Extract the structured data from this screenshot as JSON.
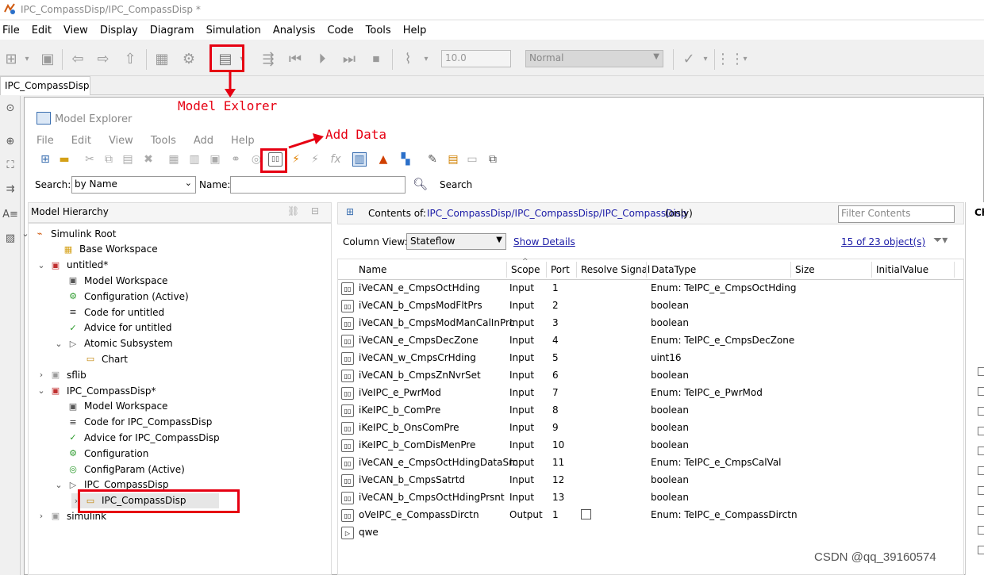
{
  "window": {
    "title": "IPC_CompassDisp/IPC_CompassDisp *"
  },
  "menu": [
    "File",
    "Edit",
    "View",
    "Display",
    "Diagram",
    "Simulation",
    "Analysis",
    "Code",
    "Tools",
    "Help"
  ],
  "toolbar": {
    "stop_time": "10.0",
    "sim_mode": "Normal"
  },
  "tab": {
    "label": "IPC_CompassDisp"
  },
  "model_explorer": {
    "title": "Model Explorer",
    "menu": [
      "File",
      "Edit",
      "View",
      "Tools",
      "Add",
      "Help"
    ],
    "search": {
      "search_label": "Search:",
      "by_value": "by Name",
      "name_label": "Name:",
      "name_value": "",
      "search_button": "Search"
    },
    "hierarchy": {
      "header": "Model Hierarchy",
      "nodes": [
        {
          "label": "Simulink Root",
          "arrow": "v",
          "icon": "simulink-root-icon"
        },
        {
          "label": "Base Workspace",
          "arrow": "",
          "icon": "workspace-icon"
        },
        {
          "label": "untitled*",
          "arrow": "v",
          "icon": "model-icon"
        },
        {
          "label": "Model Workspace",
          "arrow": "",
          "icon": "model-workspace-icon"
        },
        {
          "label": "Configuration (Active)",
          "arrow": "",
          "icon": "configuration-icon"
        },
        {
          "label": "Code for untitled",
          "arrow": "",
          "icon": "code-icon"
        },
        {
          "label": "Advice for untitled",
          "arrow": "",
          "icon": "advice-icon"
        },
        {
          "label": "Atomic Subsystem",
          "arrow": "v",
          "icon": "subsystem-icon"
        },
        {
          "label": "Chart",
          "arrow": "",
          "icon": "chart-icon"
        },
        {
          "label": "sflib",
          "arrow": ">",
          "icon": "library-icon"
        },
        {
          "label": "IPC_CompassDisp*",
          "arrow": "v",
          "icon": "model-icon"
        },
        {
          "label": "Model Workspace",
          "arrow": "",
          "icon": "model-workspace-icon"
        },
        {
          "label": "Code for IPC_CompassDisp",
          "arrow": "",
          "icon": "code-icon"
        },
        {
          "label": "Advice for IPC_CompassDisp",
          "arrow": "",
          "icon": "advice-icon"
        },
        {
          "label": "Configuration",
          "arrow": "",
          "icon": "configuration-icon"
        },
        {
          "label": "ConfigParam (Active)",
          "arrow": "",
          "icon": "configparam-icon"
        },
        {
          "label": "IPC_CompassDisp",
          "arrow": "v",
          "icon": "subsystem-icon"
        },
        {
          "label": "IPC_CompassDisp",
          "arrow": ">",
          "icon": "chart-icon"
        },
        {
          "label": "simulink",
          "arrow": ">",
          "icon": "library-icon"
        }
      ]
    },
    "contents": {
      "label": "Contents of:",
      "path": "IPC_CompassDisp/IPC_CompassDisp/IPC_CompassDisp",
      "scope_note": "(only)",
      "filter_placeholder": "Filter Contents",
      "column_view_label": "Column View:",
      "column_view_value": "Stateflow",
      "show_details": "Show Details",
      "count": "15 of 23 object(s)",
      "columns": [
        "Name",
        "Scope",
        "Port",
        "Resolve Signal",
        "DataType",
        "Size",
        "InitialValue"
      ],
      "rows": [
        {
          "name": "iVeCAN_e_CmpsOctHding",
          "scope": "Input",
          "port": "1",
          "datatype": "Enum: TeIPC_e_CmpsOctHding"
        },
        {
          "name": "iVeCAN_b_CmpsModFltPrs",
          "scope": "Input",
          "port": "2",
          "datatype": "boolean"
        },
        {
          "name": "iVeCAN_b_CmpsModManCalInPrc",
          "scope": "Input",
          "port": "3",
          "datatype": "boolean"
        },
        {
          "name": "iVeCAN_e_CmpsDecZone",
          "scope": "Input",
          "port": "4",
          "datatype": "Enum: TeIPC_e_CmpsDecZone"
        },
        {
          "name": "iVeCAN_w_CmpsCrHding",
          "scope": "Input",
          "port": "5",
          "datatype": "uint16"
        },
        {
          "name": "iVeCAN_b_CmpsZnNvrSet",
          "scope": "Input",
          "port": "6",
          "datatype": "boolean"
        },
        {
          "name": "iVeIPC_e_PwrMod",
          "scope": "Input",
          "port": "7",
          "datatype": "Enum: TeIPC_e_PwrMod"
        },
        {
          "name": "iKeIPC_b_ComPre",
          "scope": "Input",
          "port": "8",
          "datatype": "boolean"
        },
        {
          "name": "iKeIPC_b_OnsComPre",
          "scope": "Input",
          "port": "9",
          "datatype": "boolean"
        },
        {
          "name": "iKeIPC_b_ComDisMenPre",
          "scope": "Input",
          "port": "10",
          "datatype": "boolean"
        },
        {
          "name": "iVeCAN_e_CmpsOctHdingDataSrc",
          "scope": "Input",
          "port": "11",
          "datatype": "Enum: TeIPC_e_CmpsCalVal"
        },
        {
          "name": "iVeCAN_b_CmpsSatrtd",
          "scope": "Input",
          "port": "12",
          "datatype": "boolean"
        },
        {
          "name": "iVeCAN_b_CmpsOctHdingPrsnt",
          "scope": "Input",
          "port": "13",
          "datatype": "boolean"
        },
        {
          "name": "oVeIPC_e_CompassDirctn",
          "scope": "Output",
          "port": "1",
          "datatype": "Enum: TeIPC_e_CompassDirctn"
        },
        {
          "name": "qwe",
          "scope": "",
          "port": "",
          "datatype": ""
        }
      ]
    },
    "right_panel": {
      "header_fragment": "Ch"
    }
  },
  "annotations": {
    "model_explorer": "Model Exlorer",
    "add_data": "Add Data"
  },
  "watermark": "CSDN @qq_39160574",
  "colors": {
    "annotation_red": "#e60012",
    "link_blue": "#1a1aa6"
  }
}
